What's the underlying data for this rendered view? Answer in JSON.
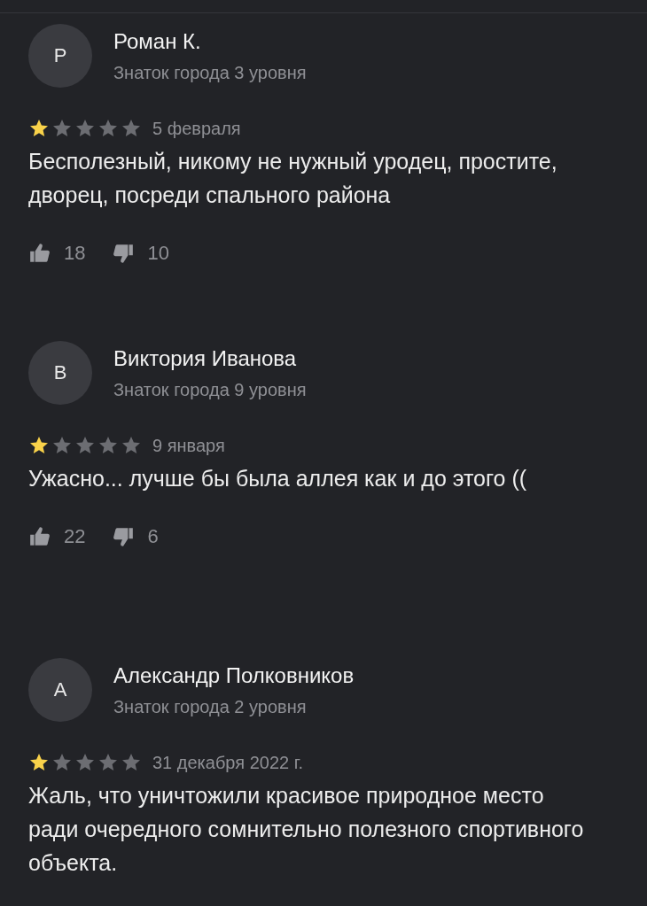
{
  "reviews": [
    {
      "initial": "Р",
      "name": "Роман К.",
      "level": "Знаток города 3 уровня",
      "stars": 1,
      "date": "5 февраля",
      "text": "Бесполезный, никому не нужный уродец, простите, дворец, посреди спального района",
      "likes": "18",
      "dislikes": "10"
    },
    {
      "initial": "В",
      "name": "Виктория Иванова",
      "level": "Знаток города 9 уровня",
      "stars": 1,
      "date": "9 января",
      "text": "Ужасно... лучше бы была аллея как и до этого ((",
      "likes": "22",
      "dislikes": "6"
    },
    {
      "initial": "А",
      "name": "Александр Полковников",
      "level": "Знаток города 2 уровня",
      "stars": 1,
      "date": "31 декабря 2022 г.",
      "text": "Жаль, что уничтожили красивое природное место ради очередного сомнительно полезного спортивного объекта."
    }
  ]
}
